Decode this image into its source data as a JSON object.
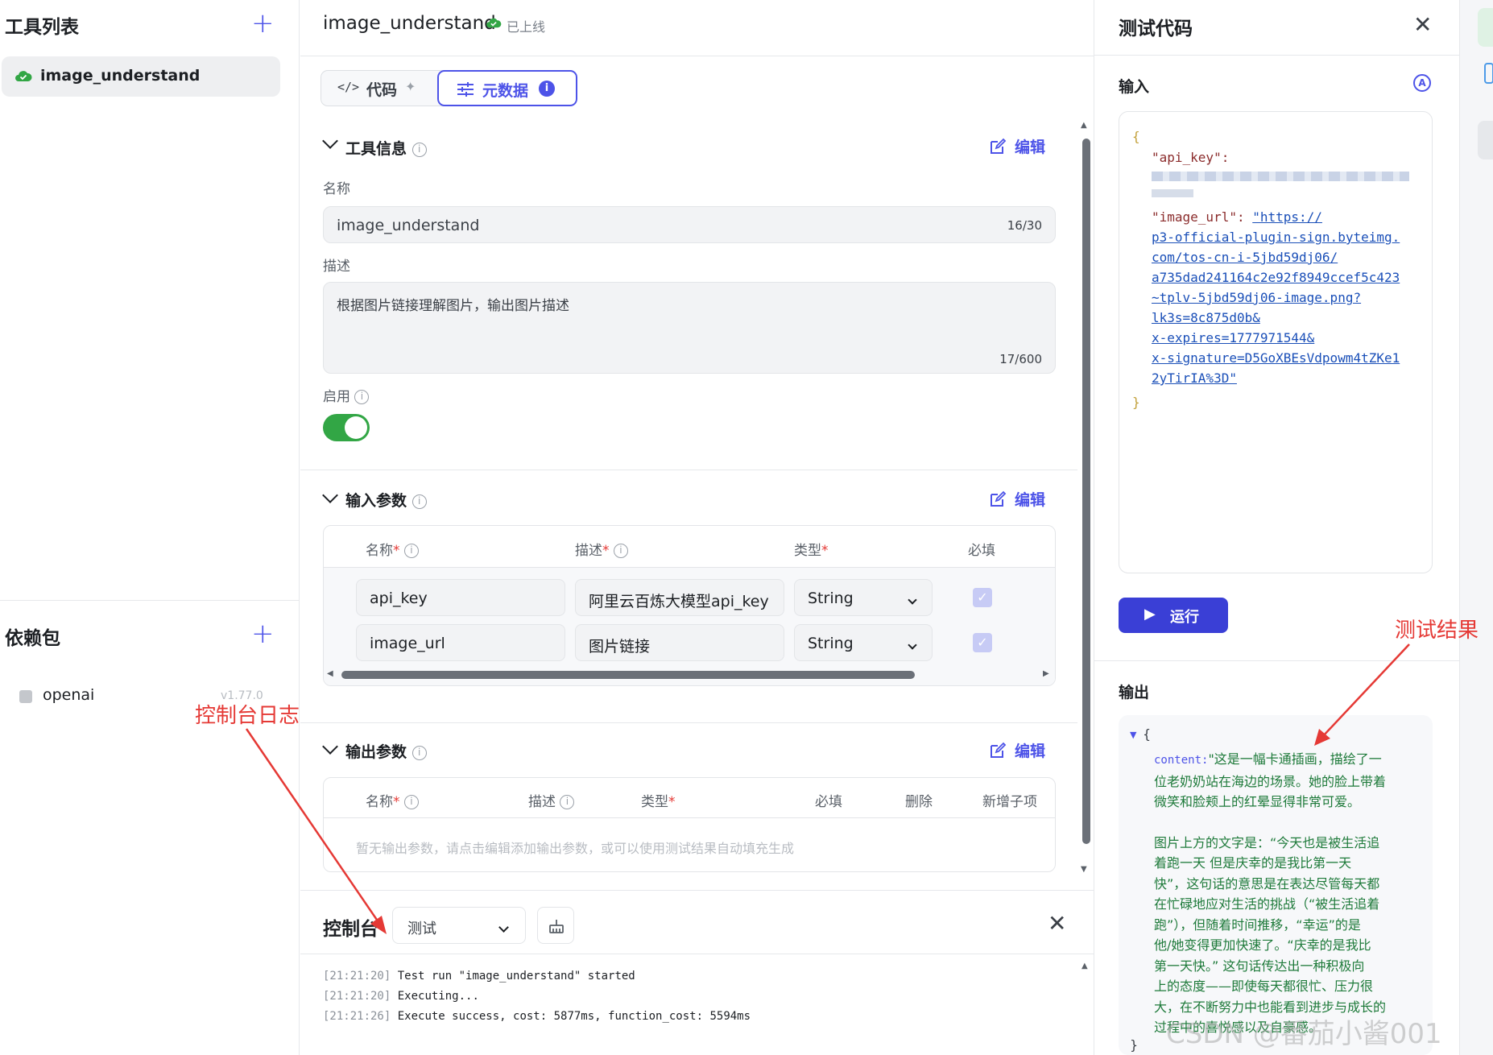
{
  "sidebar": {
    "tools_title": "工具列表",
    "tools": [
      {
        "label": "image_understand"
      }
    ],
    "deps_title": "依赖包",
    "deps": [
      {
        "name": "openai",
        "version": "v1.77.0"
      }
    ]
  },
  "header": {
    "title": "image_understand",
    "status": "已上线"
  },
  "tabs": [
    {
      "label": "代码",
      "active": false
    },
    {
      "label": "元数据",
      "active": true,
      "badge": "i"
    }
  ],
  "tool_info": {
    "section_title": "工具信息",
    "edit_label": "编辑",
    "name_label": "名称",
    "name_value": "image_understand",
    "name_counter": "16/30",
    "desc_label": "描述",
    "desc_value": "根据图片链接理解图片，输出图片描述",
    "desc_counter": "17/600",
    "enable_label": "启用",
    "enabled": true
  },
  "input_params": {
    "section_title": "输入参数",
    "edit_label": "编辑",
    "headers": {
      "name": "名称",
      "desc": "描述",
      "type": "类型",
      "required": "必填"
    },
    "rows": [
      {
        "name": "api_key",
        "desc": "阿里云百炼大模型api_key",
        "type": "String",
        "required": true
      },
      {
        "name": "image_url",
        "desc": "图片链接",
        "type": "String",
        "required": true
      }
    ]
  },
  "output_params": {
    "section_title": "输出参数",
    "edit_label": "编辑",
    "headers": {
      "name": "名称",
      "desc": "描述",
      "type": "类型",
      "required": "必填",
      "delete": "删除",
      "add_child": "新增子项"
    },
    "empty_text": "暂无输出参数，请点击编辑添加输出参数，或可以使用测试结果自动填充生成"
  },
  "console": {
    "title": "控制台",
    "select_value": "测试",
    "logs": [
      {
        "time": "[21:21:20]",
        "text": "Test run \"image_understand\" started"
      },
      {
        "time": "[21:21:20]",
        "text": "Executing..."
      },
      {
        "time": "[21:21:26]",
        "text": "Execute success, cost: 5877ms, function_cost: 5594ms"
      }
    ]
  },
  "test_panel": {
    "title": "测试代码",
    "input_label": "输入",
    "input_json": {
      "open": "{",
      "key1": "\"api_key\":",
      "key2": "\"image_url\":",
      "url_lines": [
        "\"https://",
        "p3-official-plugin-sign.byteimg.",
        "com/tos-cn-i-5jbd59dj06/",
        "a735dad241164c2e92f8949ccef5c423",
        "~tplv-5jbd59dj06-image.png?",
        "lk3s=8c875d0b&",
        "x-expires=1777971544&",
        "x-signature=D5GoXBEsVdpowm4tZKe1",
        "2yTirIA%3D\""
      ],
      "close": "}"
    },
    "run_label": "运行",
    "output_label": "输出",
    "output": {
      "open": "{",
      "key": "content:",
      "lines": [
        "\"这是一幅卡通插画，描绘了一",
        "位老奶奶站在海边的场景。她的脸上带着",
        "微笑和脸颊上的红晕显得非常可爱。",
        "",
        "图片上方的文字是：“今天也是被生活追",
        "着跑一天 但是庆幸的是我比第一天",
        "快”，这句话的意思是在表达尽管每天都",
        "在忙碌地应对生活的挑战（“被生活追着",
        "跑”），但随着时间推移，“幸运”的是",
        "他/她变得更加快速了。“庆幸的是我比",
        "第一天快。” 这句话传达出一种积极向",
        "上的态度——即使每天都很忙、压力很",
        "大，在不断努力中也能看到进步与成长的",
        "过程中的喜悦感以及自豪感。"
      ],
      "close": "}"
    }
  },
  "annotations": {
    "console_log": "控制台日志",
    "test_result": "测试结果"
  },
  "watermark": "CSDN @番茄小酱001",
  "colors": {
    "accent": "#4d53e8",
    "success": "#32a645",
    "annotation": "#e53935",
    "json_string": "#1a4fb8"
  }
}
